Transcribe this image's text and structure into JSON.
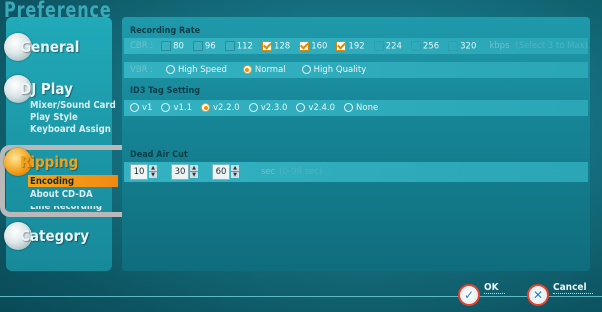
{
  "window": {
    "title": "Preference"
  },
  "sidebar": {
    "general": {
      "label": "General"
    },
    "dj_play": {
      "label": "DJ Play",
      "items": [
        "Mixer/Sound Card",
        "Play Style",
        "Keyboard Assign"
      ]
    },
    "ripping": {
      "label": "Ripping",
      "items": [
        "Encoding",
        "About CD-DA",
        "Line Recording"
      ],
      "active_item": "Encoding"
    },
    "category": {
      "label": "Category"
    }
  },
  "recording_rate": {
    "heading": "Recording Rate",
    "cbr_label": "CBR :",
    "bitrates": [
      {
        "value": "80",
        "checked": false,
        "enabled": true
      },
      {
        "value": "96",
        "checked": false,
        "enabled": true
      },
      {
        "value": "112",
        "checked": false,
        "enabled": true
      },
      {
        "value": "128",
        "checked": true,
        "enabled": true
      },
      {
        "value": "160",
        "checked": true,
        "enabled": true
      },
      {
        "value": "192",
        "checked": true,
        "enabled": true
      },
      {
        "value": "224",
        "checked": false,
        "enabled": true
      },
      {
        "value": "256",
        "checked": false,
        "enabled": true
      },
      {
        "value": "320",
        "checked": false,
        "enabled": true
      }
    ],
    "kbps_label": "kbps",
    "hint": "(Select 3 to Max)",
    "vbr_label": "VBR :",
    "vbr_options": [
      "High Speed",
      "Normal",
      "High Quality"
    ],
    "vbr_selected": "Normal"
  },
  "id3": {
    "heading": "ID3 Tag Setting",
    "options": [
      "v1",
      "v1.1",
      "v2.2.0",
      "v2.3.0",
      "v2.4.0",
      "None"
    ],
    "selected": "v2.2.0"
  },
  "dead_air": {
    "heading": "Dead Air Cut",
    "values": [
      "10",
      "30",
      "60"
    ],
    "unit": "sec",
    "range": "(0-99 sec)"
  },
  "buttons": {
    "ok": "OK",
    "cancel": "Cancel"
  },
  "colors": {
    "accent": "#f08f0c",
    "panel": "#168596",
    "danger": "#e4412e"
  }
}
